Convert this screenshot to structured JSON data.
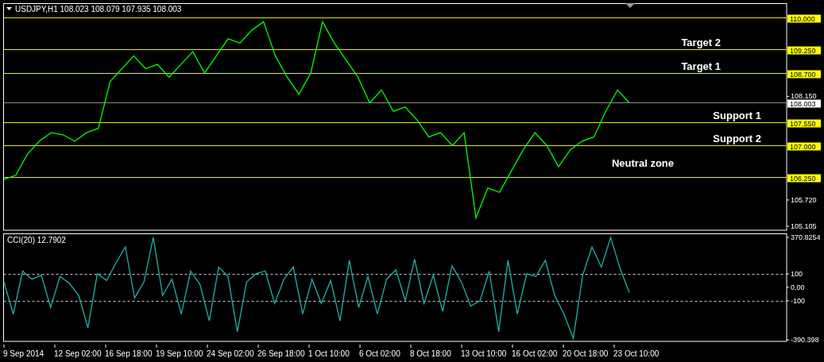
{
  "main_chart": {
    "title": "USDJPY,H1",
    "ohlc": "108.023 108.079 107.935 108.003",
    "captions": [
      {
        "text": "Target 2",
        "kind": "target"
      },
      {
        "text": "Target 1",
        "kind": "target"
      },
      {
        "text": "Support 1",
        "kind": "support"
      },
      {
        "text": "Support 2",
        "kind": "support"
      },
      {
        "text": "Neutral zone",
        "kind": "zone"
      }
    ],
    "chart_data": {
      "type": "line",
      "ylim": [
        105.012,
        110.326
      ],
      "ref_lines": [
        {
          "axis": "y",
          "value": 110.0,
          "label": "110.000",
          "color": "#e8e800"
        },
        {
          "axis": "y",
          "value": 109.25,
          "label": "109.250",
          "color": "#e8e800"
        },
        {
          "axis": "y",
          "value": 108.7,
          "label": "108.700",
          "color": "#e8e800"
        },
        {
          "axis": "y",
          "value": 108.003,
          "label": "108.003",
          "color": "#8c8c8c"
        },
        {
          "axis": "y",
          "value": 107.55,
          "label": "107.550",
          "color": "#e8e800"
        },
        {
          "axis": "y",
          "value": 107.0,
          "label": "107.000",
          "color": "#e8e800"
        },
        {
          "axis": "y",
          "value": 106.25,
          "label": "106.250",
          "color": "#e8e800"
        }
      ],
      "categories": [
        null,
        null,
        null,
        null,
        null,
        null,
        null,
        null,
        null,
        null,
        null,
        null,
        null,
        null,
        null,
        null,
        null,
        null,
        null,
        null,
        null,
        null,
        null,
        null,
        null,
        null,
        null,
        null,
        null,
        null,
        null,
        null,
        null,
        null,
        null,
        null,
        null,
        null,
        null,
        null,
        null,
        null,
        null,
        null,
        null,
        null,
        null,
        null,
        null,
        null,
        null,
        null,
        null,
        null
      ],
      "series": [
        {
          "color": "#00ff00",
          "values": [
            106.2,
            106.3,
            106.8,
            107.1,
            107.3,
            107.25,
            107.1,
            107.3,
            107.4,
            108.5,
            108.8,
            109.1,
            108.8,
            108.9,
            108.6,
            108.9,
            109.2,
            108.7,
            109.1,
            109.5,
            109.4,
            109.7,
            109.9,
            109.1,
            108.6,
            108.2,
            108.7,
            109.9,
            109.4,
            109.0,
            108.6,
            108.0,
            108.3,
            107.8,
            107.9,
            107.6,
            107.2,
            107.3,
            107.0,
            107.3,
            105.3,
            106.0,
            105.9,
            106.4,
            106.9,
            107.3,
            107.0,
            106.5,
            106.9,
            107.1,
            107.2,
            107.8,
            108.3,
            108.0
          ]
        }
      ],
      "yticks": [
        {
          "value": 108.15,
          "label": "108.150"
        },
        {
          "value": 105.72,
          "label": "105.720"
        },
        {
          "value": 105.105,
          "label": "105.105"
        }
      ]
    }
  },
  "indicator": {
    "title": "CCI(20) 12.7902",
    "chart_data": {
      "type": "line",
      "ylim": [
        -402.2,
        400.3
      ],
      "categories": [
        null,
        null,
        null,
        null,
        null,
        null,
        null,
        null,
        null,
        null,
        null,
        null,
        null,
        null,
        null,
        null,
        null,
        null,
        null,
        null,
        null,
        null,
        null,
        null,
        null,
        null,
        null,
        null,
        null,
        null,
        null,
        null,
        null,
        null,
        null,
        null,
        null,
        null,
        null,
        null,
        null,
        null,
        null,
        null,
        null,
        null,
        null,
        null,
        null,
        null,
        null,
        null,
        null,
        null,
        null,
        null,
        null,
        null,
        null,
        null,
        null,
        null,
        null,
        null,
        null,
        null,
        null,
        null
      ],
      "series": [
        {
          "color": "#20b2aa",
          "values": [
            40,
            -200,
            120,
            60,
            90,
            -150,
            80,
            30,
            -60,
            -300,
            100,
            50,
            180,
            300,
            -80,
            40,
            370,
            -60,
            60,
            -200,
            120,
            20,
            -250,
            150,
            80,
            -330,
            40,
            100,
            120,
            -120,
            60,
            150,
            -200,
            60,
            -120,
            50,
            -250,
            200,
            -150,
            80,
            -200,
            60,
            130,
            -100,
            210,
            -120,
            90,
            -180,
            160,
            40,
            -140,
            -100,
            120,
            -330,
            200,
            -200,
            100,
            80,
            200,
            -60,
            -200,
            -380,
            90,
            300,
            150,
            370,
            140,
            -40
          ]
        }
      ],
      "yticks": [
        {
          "value": 370.8254,
          "label": "370.8254"
        },
        {
          "value": 100,
          "label": "100"
        },
        {
          "value": 0,
          "label": "0.00"
        },
        {
          "value": -100,
          "label": "-100"
        },
        {
          "value": -390.398,
          "label": "-390.398"
        }
      ],
      "ref_lines": [
        {
          "axis": "y",
          "value": 100
        },
        {
          "axis": "y",
          "value": -100
        }
      ]
    }
  },
  "time_axis": {
    "labels": [
      "9 Sep 2014",
      "12 Sep 02:00",
      "16 Sep 18:00",
      "19 Sep 10:00",
      "24 Sep 02:00",
      "26 Sep 18:00",
      "1 Oct 10:00",
      "6 Oct 02:00",
      "8 Oct 18:00",
      "13 Oct 10:00",
      "16 Oct 02:00",
      "20 Oct 18:00",
      "23 Oct 10:00"
    ]
  }
}
